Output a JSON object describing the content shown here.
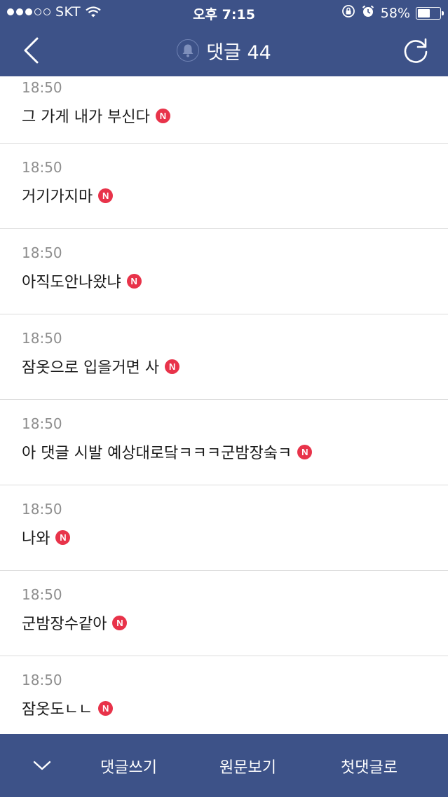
{
  "status_bar": {
    "carrier": "SKT",
    "time": "오후 7:15",
    "battery_percent": "58%",
    "battery_level": 0.58
  },
  "header": {
    "title": "댓글 44"
  },
  "comments": [
    {
      "time": "18:50",
      "text": "그 가게 내가 부신다",
      "badge": "N"
    },
    {
      "time": "18:50",
      "text": "거기가지마",
      "badge": "N"
    },
    {
      "time": "18:50",
      "text": "아직도안나왔냐",
      "badge": "N"
    },
    {
      "time": "18:50",
      "text": "잠옷으로 입을거면 사",
      "badge": "N"
    },
    {
      "time": "18:50",
      "text": "아 댓글 시발 예상대로닼ㅋㅋㅋ군밤장숰ㅋ",
      "badge": "N"
    },
    {
      "time": "18:50",
      "text": "나와",
      "badge": "N"
    },
    {
      "time": "18:50",
      "text": "군밤장수같아",
      "badge": "N"
    },
    {
      "time": "18:50",
      "text": "잠옷도ㄴㄴ",
      "badge": "N"
    }
  ],
  "bottom_bar": {
    "write_label": "댓글쓰기",
    "original_label": "원문보기",
    "first_label": "첫댓글로"
  },
  "colors": {
    "bar_background": "#3d5288",
    "new_badge": "#e8334a",
    "timestamp": "#8e8e8e"
  }
}
